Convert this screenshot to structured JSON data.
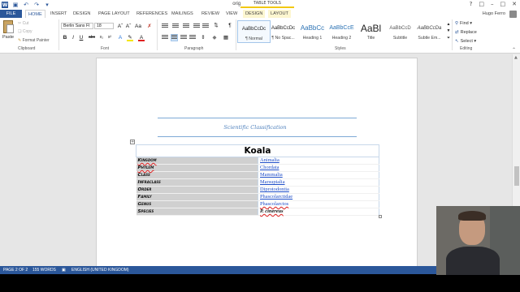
{
  "window": {
    "title": "originalkoala.docx - Word",
    "controls": [
      "?",
      "□",
      "–",
      "□",
      "✕"
    ],
    "contextual_group": "TABLE TOOLS"
  },
  "tabs": [
    {
      "label": "FILE"
    },
    {
      "label": "HOME"
    },
    {
      "label": "INSERT"
    },
    {
      "label": "DESIGN"
    },
    {
      "label": "PAGE LAYOUT"
    },
    {
      "label": "REFERENCES"
    },
    {
      "label": "MAILINGS"
    },
    {
      "label": "REVIEW"
    },
    {
      "label": "VIEW"
    },
    {
      "label": "DESIGN"
    },
    {
      "label": "LAYOUT"
    }
  ],
  "user": {
    "name": "Hugo Ferro"
  },
  "ribbon": {
    "clipboard": {
      "paste": "Paste",
      "cut": "Cut",
      "copy": "Copy",
      "format_painter": "Format Painter",
      "label": "Clipboard"
    },
    "font": {
      "family": "Berlin Sans FI",
      "size": "18",
      "label": "Font"
    },
    "paragraph": {
      "label": "Paragraph"
    },
    "styles": {
      "label": "Styles",
      "items": [
        {
          "sample": "AaBbCcDc",
          "name": "¶ Normal"
        },
        {
          "sample": "AaBbCcDc",
          "name": "¶ No Spac..."
        },
        {
          "sample": "AaBbCc",
          "name": "Heading 1"
        },
        {
          "sample": "AaBbCcE",
          "name": "Heading 2"
        },
        {
          "sample": "AaBl",
          "name": "Title"
        },
        {
          "sample": "AaBbCcD",
          "name": "Subtitle"
        },
        {
          "sample": "AaBbCcDa",
          "name": "Subtle Em..."
        }
      ]
    },
    "editing": {
      "find": "Find",
      "replace": "Replace",
      "select": "Select",
      "label": "Editing"
    }
  },
  "document": {
    "caption": "Scientific Classification",
    "table_title": "Koala",
    "rows": [
      {
        "rank": "Kingdom",
        "value": "Animalia"
      },
      {
        "rank": "Phylum",
        "value": "Chordata"
      },
      {
        "rank": "Class",
        "value": "Mammalia"
      },
      {
        "rank": "Infraclass",
        "value": "Marsupialia"
      },
      {
        "rank": "Order",
        "value": "Diprotodontia"
      },
      {
        "rank": "Family",
        "value": "Phascolarctidae"
      },
      {
        "rank": "Genus",
        "value": "Phascolarctos"
      },
      {
        "rank": "Species",
        "value": "P. cinereus"
      }
    ]
  },
  "status": {
    "page": "PAGE 2 OF 2",
    "words": "155 WORDS",
    "language": "ENGLISH (UNITED KINGDOM)"
  }
}
